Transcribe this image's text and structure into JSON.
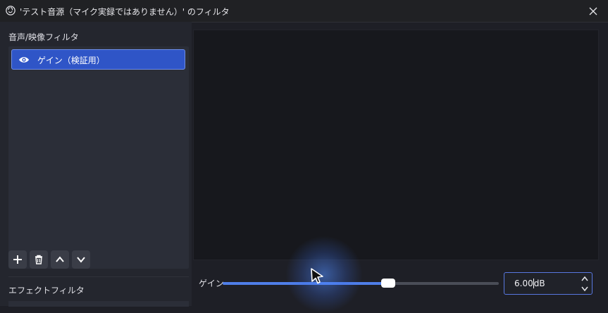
{
  "window": {
    "title": "'テスト音源（マイク実録ではありません）' のフィルタ"
  },
  "left": {
    "audio_video_label": "音声/映像フィルタ",
    "filters": [
      {
        "label": "ゲイン（検証用）",
        "visible": true,
        "selected": true
      }
    ],
    "effect_label": "エフェクトフィルタ"
  },
  "gain": {
    "label": "ゲイン",
    "value_number": "6.00",
    "unit": "dB",
    "slider_fraction": 0.6
  },
  "colors": {
    "accent": "#2f55c7",
    "slider_fill": "#4f7ee8"
  }
}
